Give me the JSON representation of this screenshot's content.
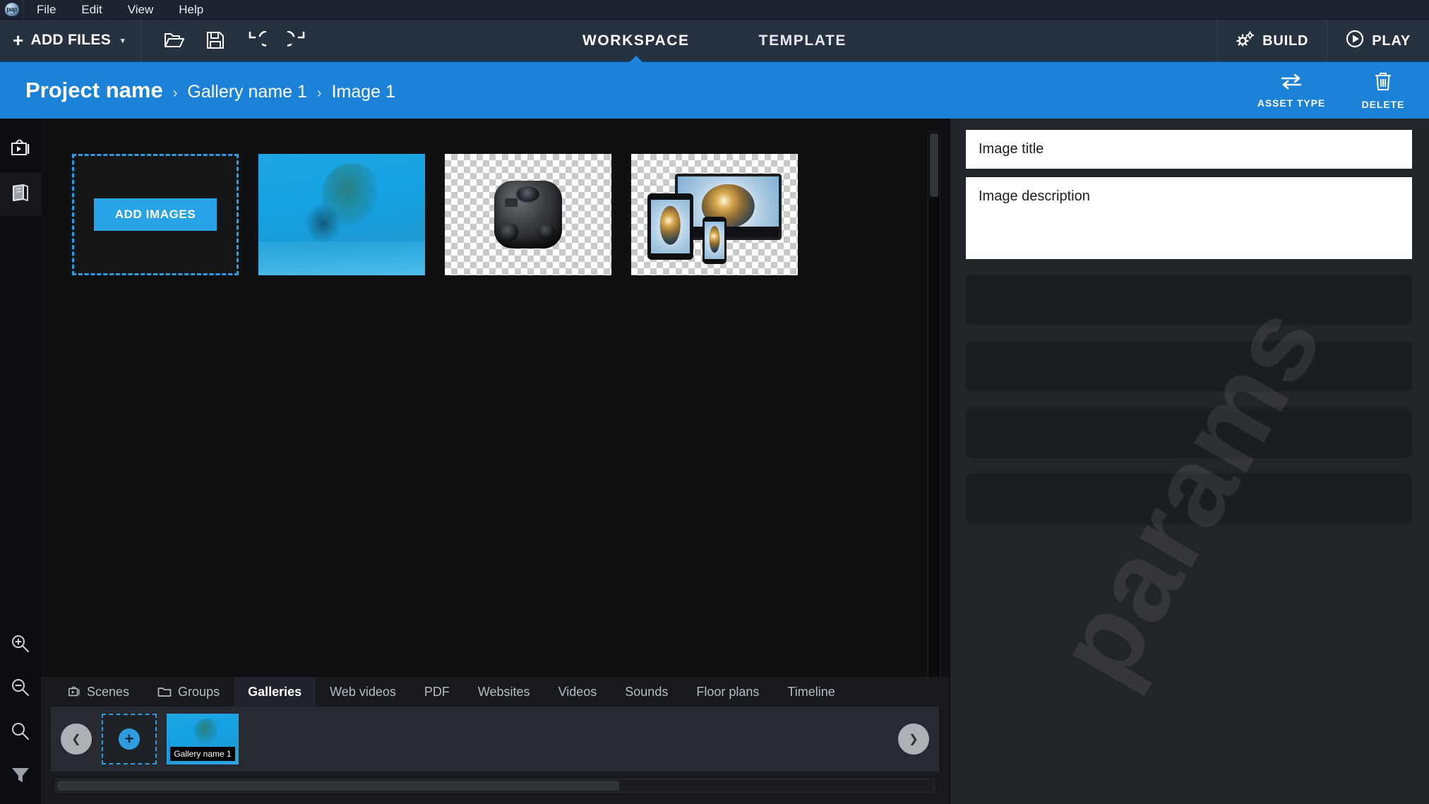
{
  "app": {
    "logo_text": "pap",
    "menu": [
      "File",
      "Edit",
      "View",
      "Help"
    ],
    "accent_blue": "#1b82d8",
    "toolbar_bg": "#273240",
    "canvas_bg": "#0f1012"
  },
  "toolbar": {
    "add_files_label": "ADD FILES",
    "add_files_plus": "+",
    "add_files_caret": "▾",
    "icons": [
      {
        "name": "open-folder-icon",
        "title": "Open"
      },
      {
        "name": "save-icon",
        "title": "Save"
      },
      {
        "name": "undo-icon",
        "title": "Undo"
      },
      {
        "name": "redo-icon",
        "title": "Redo"
      }
    ],
    "tabs": [
      {
        "label": "WORKSPACE",
        "active": true
      },
      {
        "label": "TEMPLATE",
        "active": false
      }
    ],
    "build_label": "BUILD",
    "play_label": "PLAY"
  },
  "breadcrumb": {
    "project": "Project name",
    "separator": "›",
    "items": [
      "Gallery name 1",
      "Image 1"
    ],
    "actions": [
      {
        "label": "ASSET TYPE",
        "icon": "swap-arrows-icon"
      },
      {
        "label": "DELETE",
        "icon": "trash-icon"
      }
    ]
  },
  "rail": {
    "top_items": [
      {
        "name": "scenes-icon",
        "label": "Scenes"
      },
      {
        "name": "library-book-icon",
        "label": "Library"
      }
    ],
    "bottom_items": [
      {
        "name": "zoom-in-icon",
        "label": "Zoom in"
      },
      {
        "name": "zoom-out-icon",
        "label": "Zoom out"
      },
      {
        "name": "zoom-reset-icon",
        "label": "Zoom reset"
      },
      {
        "name": "filter-icon",
        "label": "Filter"
      }
    ]
  },
  "canvas": {
    "add_images_label": "ADD IMAGES",
    "thumbnails": [
      {
        "kind": "add-placeholder",
        "label": "ADD IMAGES"
      },
      {
        "kind": "underwater-photo",
        "label": ""
      },
      {
        "kind": "camera-rig-transparent",
        "label": ""
      },
      {
        "kind": "devices-transparent",
        "label": ""
      }
    ]
  },
  "bottom": {
    "tabs": [
      {
        "label": "Scenes",
        "icon": "tv-icon",
        "active": false
      },
      {
        "label": "Groups",
        "icon": "folder-icon",
        "active": false
      },
      {
        "label": "Galleries",
        "icon": "",
        "active": true
      },
      {
        "label": "Web videos",
        "icon": "",
        "active": false
      },
      {
        "label": "PDF",
        "icon": "",
        "active": false
      },
      {
        "label": "Websites",
        "icon": "",
        "active": false
      },
      {
        "label": "Videos",
        "icon": "",
        "active": false
      },
      {
        "label": "Sounds",
        "icon": "",
        "active": false
      },
      {
        "label": "Floor plans",
        "icon": "",
        "active": false
      },
      {
        "label": "Timeline",
        "icon": "",
        "active": false
      }
    ],
    "prev_arrow": "❮",
    "next_arrow": "❯",
    "add_gallery_plus": "+",
    "galleries": [
      {
        "label": "Gallery name 1",
        "selected": true
      }
    ],
    "h_scroll_percent": 64
  },
  "params": {
    "watermark": "params",
    "title_field": {
      "value": "Image title",
      "placeholder": "Image title"
    },
    "description_field": {
      "value": "Image description",
      "placeholder": "Image description"
    },
    "placeholder_blocks": 4
  }
}
